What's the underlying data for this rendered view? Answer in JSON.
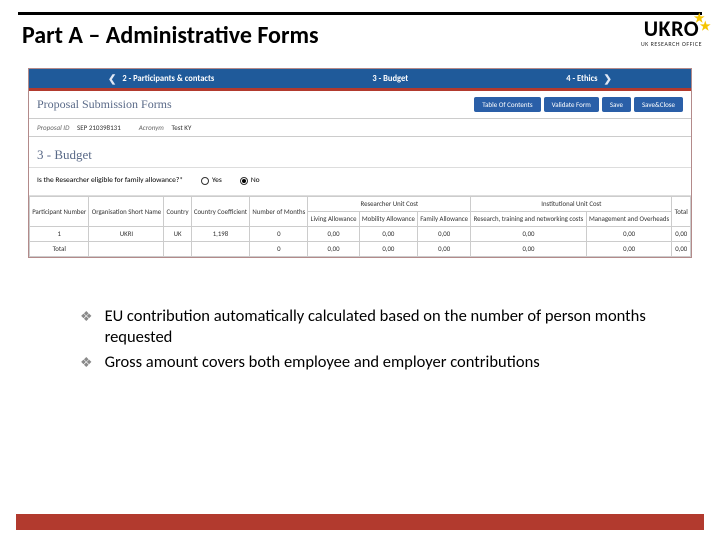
{
  "header": {
    "title": "Part A – Administrative Forms",
    "logo_text": "UKRO",
    "logo_sub": "UK RESEARCH OFFICE"
  },
  "tabs": {
    "t1": "2 - Participants & contacts",
    "t2": "3 - Budget",
    "t3": "4 - Ethics"
  },
  "forms_head": {
    "title": "Proposal Submission Forms",
    "toc": "Table Of Contents",
    "validate": "Validate Form",
    "save": "Save",
    "save_close": "Save&Close"
  },
  "meta": {
    "id_label": "Proposal ID",
    "id_value": "SEP 210398131",
    "acr_label": "Acronym",
    "acr_value": "Test KY"
  },
  "section_title": "3 - Budget",
  "question": {
    "text": "Is the Researcher eligible for family allowance?*",
    "yes": "Yes",
    "no": "No"
  },
  "table": {
    "headers": {
      "pn": "Participant Number",
      "org": "Organisation Short Name",
      "country": "Country",
      "coef": "Country Coefficient",
      "months": "Number of Months",
      "ruc_group": "Researcher Unit Cost",
      "living": "Living Allowance",
      "mobility": "Mobility Allowance",
      "family": "Family Allowance",
      "iuc_group": "Institutional Unit Cost",
      "research": "Research, training and networking costs",
      "mgmt": "Management and Overheads",
      "total": "Total"
    },
    "rows": [
      {
        "pn": "1",
        "org": "UKRI",
        "country": "UK",
        "coef": "1,198",
        "months": "0",
        "living": "0,00",
        "mobility": "0,00",
        "family": "0,00",
        "research": "0,00",
        "mgmt": "0,00",
        "total": "0,00"
      }
    ],
    "total_label": "Total",
    "totals": {
      "months": "0",
      "living": "0,00",
      "mobility": "0,00",
      "family": "0,00",
      "research": "0,00",
      "mgmt": "0,00",
      "total": "0,00"
    }
  },
  "bullets": {
    "b1": "EU contribution automatically calculated based on the number of person months requested",
    "b2": "Gross amount covers both employee and employer contributions"
  }
}
